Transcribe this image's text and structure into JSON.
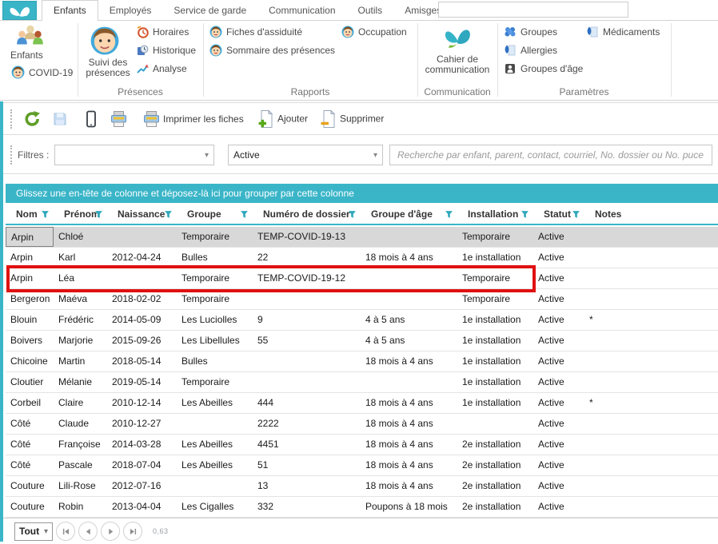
{
  "colors": {
    "teal": "#3ab5c8",
    "highlight_red": "#e01111"
  },
  "tabs": [
    {
      "label": "Enfants",
      "active": true
    },
    {
      "label": "Employés",
      "active": false
    },
    {
      "label": "Service de garde",
      "active": false
    },
    {
      "label": "Communication",
      "active": false
    },
    {
      "label": "Outils",
      "active": false
    },
    {
      "label": "Amisgest",
      "active": false
    }
  ],
  "tabbar_input_value": "",
  "ribbon": {
    "enfants_label": "Enfants",
    "covid_label": "COVID-19",
    "suivi_label": "Suivi des présences",
    "horaires_label": "Horaires",
    "historique_label": "Historique",
    "analyse_label": "Analyse",
    "presences_group": "Présences",
    "fiches_label": "Fiches d'assiduité",
    "sommaire_label": "Sommaire des présences",
    "occupation_label": "Occupation",
    "rapports_group": "Rapports",
    "cahier_label": "Cahier de communication",
    "communication_group": "Communication",
    "groupes_label": "Groupes",
    "allergies_label": "Allergies",
    "groupes_age_label": "Groupes d'âge",
    "medicaments_label": "Médicaments",
    "parametres_group": "Paramètres"
  },
  "toolbar": {
    "print_fiches_label": "Imprimer les fiches",
    "add_label": "Ajouter",
    "delete_label": "Supprimer"
  },
  "filterbar": {
    "label": "Filtres :",
    "filter1_value": "",
    "filter2_value": "Active",
    "search_placeholder": "Recherche par enfant, parent, contact, courriel, No. dossier ou No. puce"
  },
  "grid": {
    "group_hint": "Glissez une en-tête de colonne et déposez-là ici pour grouper par cette colonne",
    "columns": [
      "Nom",
      "Prénom",
      "Naissance",
      "Groupe",
      "Numéro de dossier",
      "Groupe d'âge",
      "Installation",
      "Statut",
      "Notes"
    ],
    "rows": [
      [
        "Arpin",
        "Chloé",
        "",
        "Temporaire",
        "TEMP-COVID-19-13",
        "",
        "Temporaire",
        "Active",
        ""
      ],
      [
        "Arpin",
        "Karl",
        "2012-04-24",
        "Bulles",
        "22",
        "18 mois à 4 ans",
        "1e installation",
        "Active",
        ""
      ],
      [
        "Arpin",
        "Léa",
        "",
        "Temporaire",
        "TEMP-COVID-19-12",
        "",
        "Temporaire",
        "Active",
        ""
      ],
      [
        "Bergeron",
        "Maéva",
        "2018-02-02",
        "Temporaire",
        "",
        "",
        "Temporaire",
        "Active",
        ""
      ],
      [
        "Blouin",
        "Frédéric",
        "2014-05-09",
        "Les Luciolles",
        "9",
        "4 à 5 ans",
        "1e installation",
        "Active",
        "*"
      ],
      [
        "Boivers",
        "Marjorie",
        "2015-09-26",
        "Les Libellules",
        "55",
        "4 à 5 ans",
        "1e installation",
        "Active",
        ""
      ],
      [
        "Chicoine",
        "Martin",
        "2018-05-14",
        "Bulles",
        "",
        "18 mois à 4 ans",
        "1e installation",
        "Active",
        ""
      ],
      [
        "Cloutier",
        "Mélanie",
        "2019-05-14",
        "Temporaire",
        "",
        "",
        "1e installation",
        "Active",
        ""
      ],
      [
        "Corbeil",
        "Claire",
        "2010-12-14",
        "Les Abeilles",
        "444",
        "18 mois à 4 ans",
        "1e installation",
        "Active",
        "*"
      ],
      [
        "Côté",
        "Claude",
        "2010-12-27",
        "",
        "2222",
        "18 mois à 4 ans",
        "",
        "Active",
        ""
      ],
      [
        "Côté",
        "Françoise",
        "2014-03-28",
        "Les Abeilles",
        "4451",
        "18 mois à 4 ans",
        "2e installation",
        "Active",
        ""
      ],
      [
        "Côté",
        "Pascale",
        "2018-07-04",
        "Les Abeilles",
        "51",
        "18 mois à 4 ans",
        "2e installation",
        "Active",
        ""
      ],
      [
        "Couture",
        "Lili-Rose",
        "2012-07-16",
        "",
        "13",
        "18 mois à 4 ans",
        "2e installation",
        "Active",
        ""
      ],
      [
        "Couture",
        "Robin",
        "2013-04-04",
        "Les Cigalles",
        "332",
        "Poupons à 18 mois",
        "2e installation",
        "Active",
        ""
      ]
    ],
    "selected_row_index": 0,
    "red_highlight_row_index": 2
  },
  "footer": {
    "page_size_value": "Tout",
    "ratio_label": "0,63"
  }
}
